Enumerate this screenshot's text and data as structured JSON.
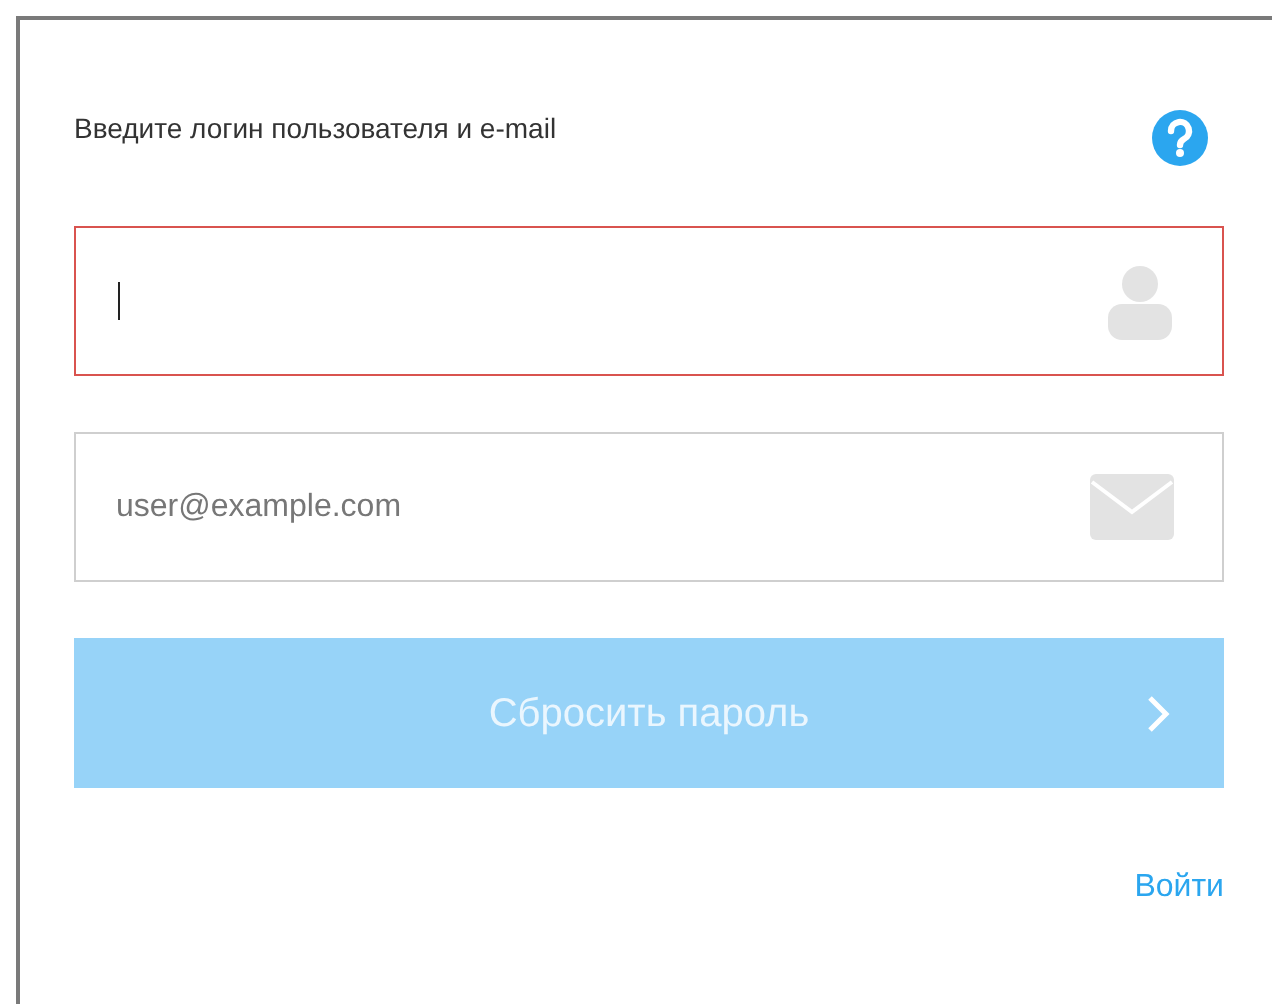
{
  "heading": "Введите логин пользователя и e-mail",
  "fields": [
    {
      "kind": "login",
      "invalid": true,
      "focused": true
    },
    {
      "kind": "email",
      "placeholder": "user@example.com",
      "invalid": false,
      "focused": false
    }
  ],
  "submit": {
    "label": "Сбросить пароль",
    "disabled": true
  },
  "login_link": "Войти"
}
